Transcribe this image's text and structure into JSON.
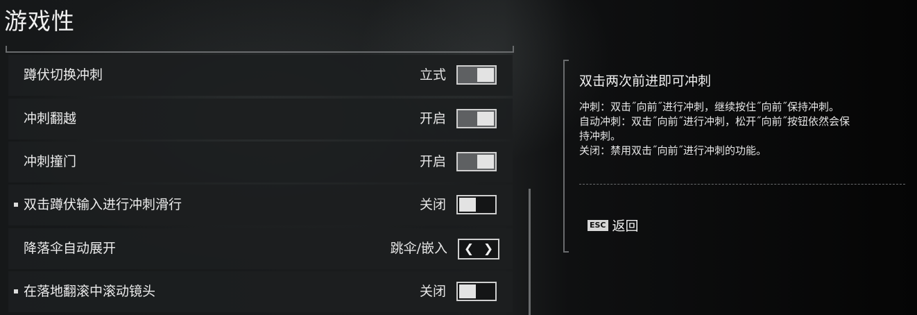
{
  "page": {
    "title": "游戏性"
  },
  "settings": [
    {
      "label": "蹲伏切换冲刺",
      "value": "立式",
      "control": "toggle",
      "state": "on",
      "marker": false
    },
    {
      "label": "冲刺翻越",
      "value": "开启",
      "control": "toggle",
      "state": "on",
      "marker": false
    },
    {
      "label": "冲刺撞门",
      "value": "开启",
      "control": "toggle",
      "state": "on",
      "marker": false
    },
    {
      "label": "双击蹲伏输入进行冲刺滑行",
      "value": "关闭",
      "control": "toggle",
      "state": "off",
      "marker": true
    },
    {
      "label": "降落伞自动展开",
      "value": "跳伞/嵌入",
      "control": "stepper",
      "prev": "❮",
      "next": "❯",
      "marker": false
    },
    {
      "label": "在落地翻滚中滚动镜头",
      "value": "关闭",
      "control": "toggle",
      "state": "off",
      "marker": true
    }
  ],
  "info": {
    "title": "双击两次前进即可冲刺",
    "lines": [
      "冲刺：双击˝向前˝进行冲刺，继续按住˝向前˝保持冲刺。",
      "自动冲刺：双击˝向前˝进行冲刺，松开˝向前˝按钮依然会保",
      "持冲刺。",
      "关闭：禁用双击˝向前˝进行冲刺的功能。"
    ]
  },
  "footer": {
    "key": "ESC",
    "label": "返回"
  },
  "colors": {
    "toggle_on": "#5e6062",
    "toggle_knob": "#e3e3e3",
    "row_bg": "#1c1e20"
  }
}
